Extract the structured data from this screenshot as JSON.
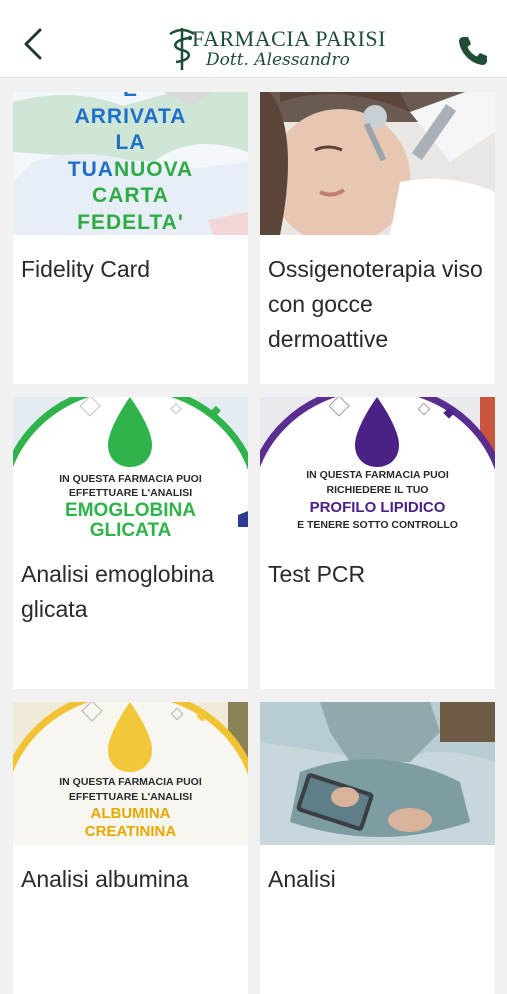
{
  "header": {
    "brand_name": "FARMACIA PARISI",
    "brand_sub": "Dott. Alessandro",
    "back_icon": "chevron-left-icon",
    "phone_icon": "phone-icon",
    "accent_color": "#1f4d36"
  },
  "cards": [
    {
      "title": "Fidelity Card",
      "image": {
        "line1": "E",
        "line2": "ARRIVATA",
        "line3": "LA",
        "line4a": "TUA",
        "line4b": "NUOVA",
        "line5": "CARTA",
        "line6": "FEDELTA'"
      }
    },
    {
      "title": "Ossigenoterapia viso con gocce dermoattive"
    },
    {
      "title": "Analisi emoglobina glicata",
      "image": {
        "line1": "IN QUESTA FARMACIA PUOI",
        "line2": "EFFETTUARE L'ANALISI",
        "line3": "EMOGLOBINA",
        "line4": "GLICATA"
      }
    },
    {
      "title": "Test PCR",
      "image": {
        "line1": "IN QUESTA FARMACIA PUOI",
        "line2": "RICHIEDERE IL TUO",
        "line3": "PROFILO LIPIDICO",
        "line4": "E TENERE SOTTO CONTROLLO"
      }
    },
    {
      "title": "Analisi albumina",
      "image": {
        "line1": "IN QUESTA FARMACIA PUOI",
        "line2": "EFFETTUARE L'ANALISI",
        "line3": "ALBUMINA",
        "line4": "CREATININA"
      }
    },
    {
      "title": "Analisi"
    }
  ]
}
